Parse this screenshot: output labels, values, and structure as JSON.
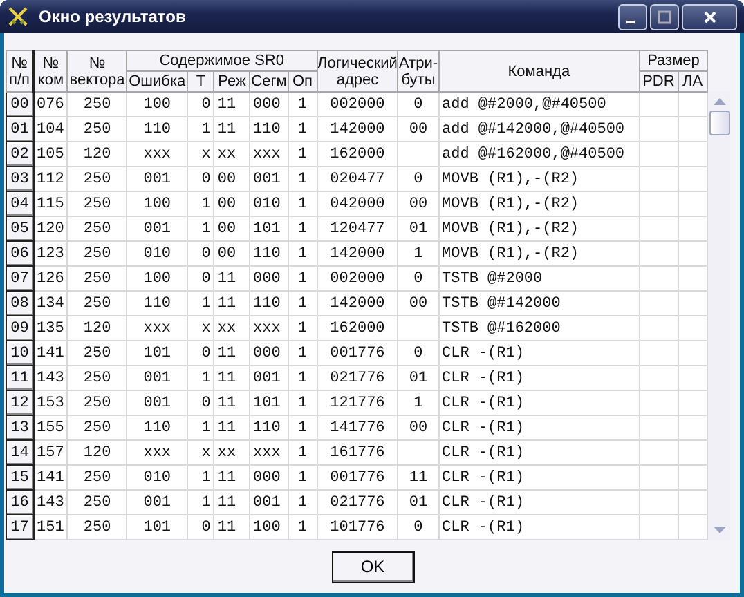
{
  "window": {
    "title": "Окно результатов"
  },
  "header": {
    "num": "№ п/п",
    "cmd_no": "№ ком",
    "vector": "№ вектора",
    "sr0": "Содержимое SR0",
    "error": "Ошибка",
    "t": "Т",
    "mode": "Реж",
    "seg": "Сегм",
    "op": "Оп",
    "address": "Логический адрес",
    "attributes": "Атри-буты",
    "command": "Команда",
    "size": "Размер",
    "pdr": "PDR",
    "la": "ЛА"
  },
  "rows": [
    {
      "num": "00",
      "cmd_no": "076",
      "vector": "250",
      "error": "100",
      "t": "0",
      "mode": "11",
      "seg": "000",
      "op": "1",
      "address": "002000",
      "attributes": "0",
      "command": "add @#2000,@#40500"
    },
    {
      "num": "01",
      "cmd_no": "104",
      "vector": "250",
      "error": "110",
      "t": "1",
      "mode": "11",
      "seg": "110",
      "op": "1",
      "address": "142000",
      "attributes": "00",
      "command": "add @#142000,@#40500"
    },
    {
      "num": "02",
      "cmd_no": "105",
      "vector": "120",
      "error": "xxx",
      "t": "x",
      "mode": "xx",
      "seg": "xxx",
      "op": "1",
      "address": "162000",
      "attributes": "",
      "command": "add @#162000,@#40500"
    },
    {
      "num": "03",
      "cmd_no": "112",
      "vector": "250",
      "error": "001",
      "t": "0",
      "mode": "00",
      "seg": "001",
      "op": "1",
      "address": "020477",
      "attributes": "0",
      "command": "MOVB (R1),-(R2)"
    },
    {
      "num": "04",
      "cmd_no": "115",
      "vector": "250",
      "error": "100",
      "t": "1",
      "mode": "00",
      "seg": "010",
      "op": "1",
      "address": "042000",
      "attributes": "00",
      "command": "MOVB (R1),-(R2)"
    },
    {
      "num": "05",
      "cmd_no": "120",
      "vector": "250",
      "error": "001",
      "t": "1",
      "mode": "00",
      "seg": "101",
      "op": "1",
      "address": "120477",
      "attributes": "01",
      "command": "MOVB (R1),-(R2)"
    },
    {
      "num": "06",
      "cmd_no": "123",
      "vector": "250",
      "error": "010",
      "t": "0",
      "mode": "00",
      "seg": "110",
      "op": "1",
      "address": "142000",
      "attributes": "1",
      "command": "MOVB (R1),-(R2)"
    },
    {
      "num": "07",
      "cmd_no": "126",
      "vector": "250",
      "error": "100",
      "t": "0",
      "mode": "11",
      "seg": "000",
      "op": "1",
      "address": "002000",
      "attributes": "0",
      "command": "TSTB @#2000"
    },
    {
      "num": "08",
      "cmd_no": "134",
      "vector": "250",
      "error": "110",
      "t": "1",
      "mode": "11",
      "seg": "110",
      "op": "1",
      "address": "142000",
      "attributes": "00",
      "command": "TSTB @#142000"
    },
    {
      "num": "09",
      "cmd_no": "135",
      "vector": "120",
      "error": "xxx",
      "t": "x",
      "mode": "xx",
      "seg": "xxx",
      "op": "1",
      "address": "162000",
      "attributes": "",
      "command": "TSTB @#162000"
    },
    {
      "num": "10",
      "cmd_no": "141",
      "vector": "250",
      "error": "101",
      "t": "0",
      "mode": "11",
      "seg": "000",
      "op": "1",
      "address": "001776",
      "attributes": "0",
      "command": "CLR -(R1)"
    },
    {
      "num": "11",
      "cmd_no": "143",
      "vector": "250",
      "error": "001",
      "t": "1",
      "mode": "11",
      "seg": "001",
      "op": "1",
      "address": "021776",
      "attributes": "01",
      "command": "CLR -(R1)"
    },
    {
      "num": "12",
      "cmd_no": "153",
      "vector": "250",
      "error": "001",
      "t": "0",
      "mode": "11",
      "seg": "101",
      "op": "1",
      "address": "121776",
      "attributes": "1",
      "command": "CLR -(R1)"
    },
    {
      "num": "13",
      "cmd_no": "155",
      "vector": "250",
      "error": "110",
      "t": "1",
      "mode": "11",
      "seg": "110",
      "op": "1",
      "address": "141776",
      "attributes": "00",
      "command": "CLR -(R1)"
    },
    {
      "num": "14",
      "cmd_no": "157",
      "vector": "120",
      "error": "xxx",
      "t": "x",
      "mode": "xx",
      "seg": "xxx",
      "op": "1",
      "address": "161776",
      "attributes": "",
      "command": "CLR -(R1)"
    },
    {
      "num": "15",
      "cmd_no": "141",
      "vector": "250",
      "error": "010",
      "t": "1",
      "mode": "11",
      "seg": "000",
      "op": "1",
      "address": "001776",
      "attributes": "11",
      "command": "CLR -(R1)"
    },
    {
      "num": "16",
      "cmd_no": "143",
      "vector": "250",
      "error": "001",
      "t": "1",
      "mode": "11",
      "seg": "001",
      "op": "1",
      "address": "021776",
      "attributes": "01",
      "command": "CLR -(R1)"
    },
    {
      "num": "17",
      "cmd_no": "151",
      "vector": "250",
      "error": "101",
      "t": "0",
      "mode": "11",
      "seg": "100",
      "op": "1",
      "address": "101776",
      "attributes": "0",
      "command": "CLR -(R1)"
    }
  ],
  "buttons": [
    {
      "label": "OK"
    }
  ]
}
